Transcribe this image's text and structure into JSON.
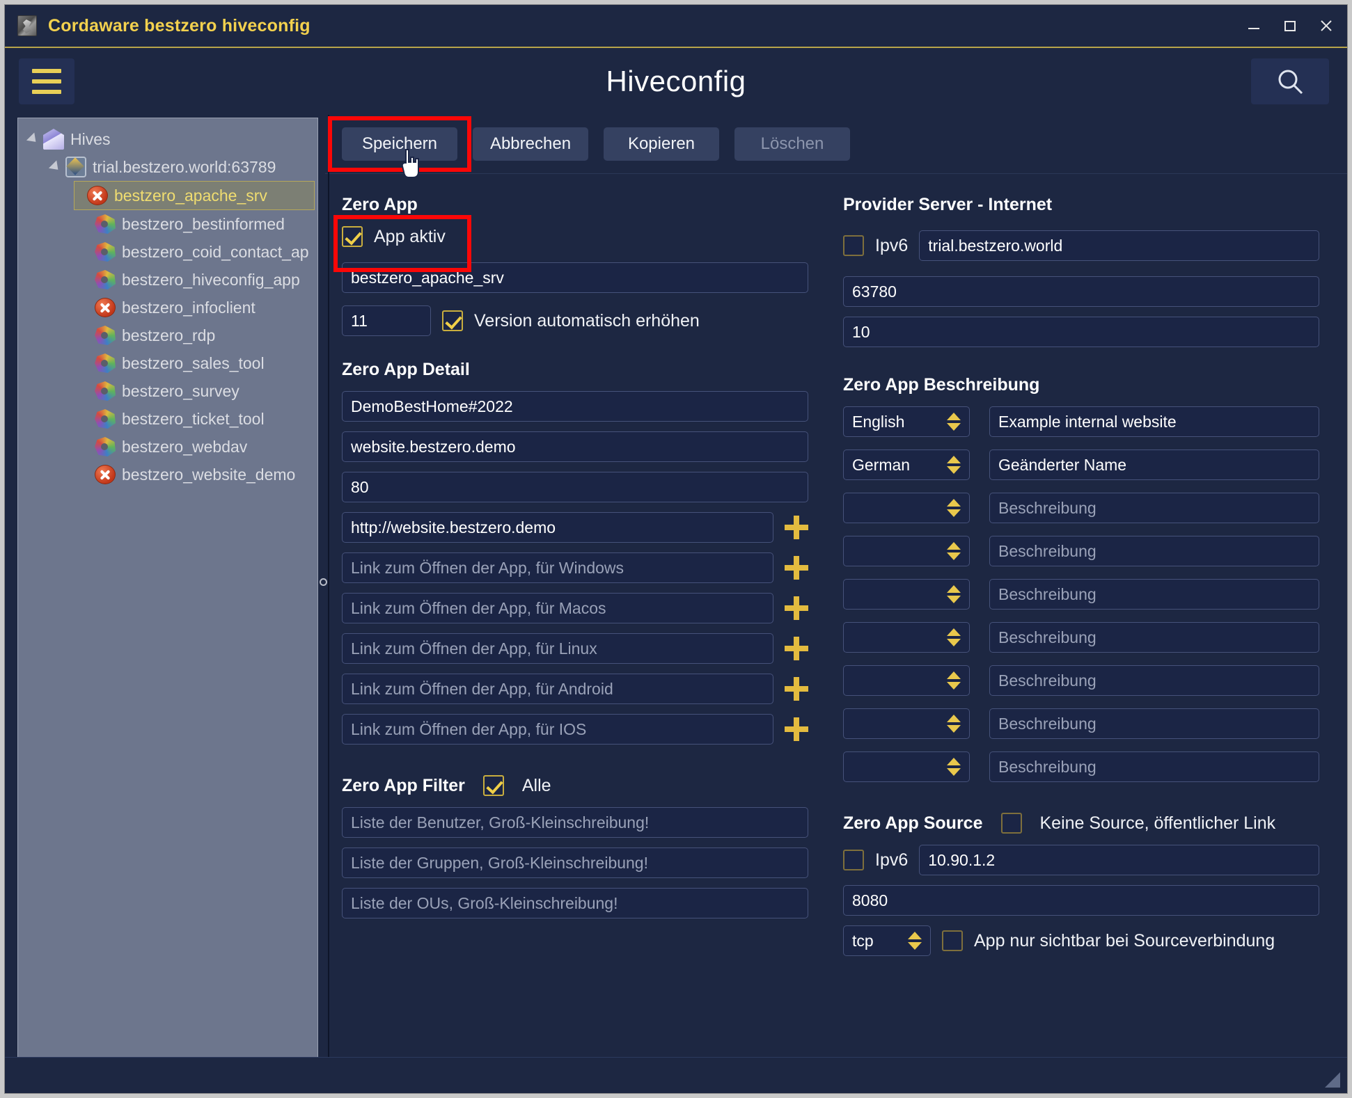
{
  "window": {
    "title": "Cordaware bestzero hiveconfig",
    "minimize": "minimize-icon",
    "maximize": "maximize-icon",
    "close": "close-icon"
  },
  "header": {
    "menu_icon": "hamburger-icon",
    "page_title": "Hiveconfig",
    "search_icon": "search-icon"
  },
  "sidebar": {
    "root": {
      "label": "Hives",
      "icon": "hive-icon"
    },
    "server": {
      "label": "trial.bestzero.world:63789",
      "icon": "world-icon"
    },
    "items": [
      {
        "label": "bestzero_apache_srv",
        "icon": "error-icon",
        "selected": true
      },
      {
        "label": "bestzero_bestinformed",
        "icon": "app-icon",
        "selected": false
      },
      {
        "label": "bestzero_coid_contact_ap",
        "icon": "app-icon",
        "selected": false
      },
      {
        "label": "bestzero_hiveconfig_app",
        "icon": "app-icon",
        "selected": false
      },
      {
        "label": "bestzero_infoclient",
        "icon": "error-icon",
        "selected": false
      },
      {
        "label": "bestzero_rdp",
        "icon": "app-icon",
        "selected": false
      },
      {
        "label": "bestzero_sales_tool",
        "icon": "app-icon",
        "selected": false
      },
      {
        "label": "bestzero_survey",
        "icon": "app-icon",
        "selected": false
      },
      {
        "label": "bestzero_ticket_tool",
        "icon": "app-icon",
        "selected": false
      },
      {
        "label": "bestzero_webdav",
        "icon": "app-icon",
        "selected": false
      },
      {
        "label": "bestzero_website_demo",
        "icon": "error-icon",
        "selected": false
      }
    ]
  },
  "toolbar": {
    "save_label": "Speichern",
    "cancel_label": "Abbrechen",
    "copy_label": "Kopieren",
    "delete_label": "Löschen"
  },
  "zero_app": {
    "section_title": "Zero App",
    "app_active_label": "App aktiv",
    "app_active_checked": true,
    "name_value": "bestzero_apache_srv",
    "version_value": "11",
    "auto_version_label": "Version automatisch erhöhen",
    "auto_version_checked": true
  },
  "provider_server": {
    "section_title": "Provider Server - Internet",
    "ipv6_label": "Ipv6",
    "ipv6_checked": false,
    "host_value": "trial.bestzero.world",
    "port_value": "63780",
    "extra_value": "10"
  },
  "zero_app_detail": {
    "section_title": "Zero App Detail",
    "fields": [
      {
        "value": "DemoBestHome#2022",
        "placeholder": "",
        "has_plus": false
      },
      {
        "value": "website.bestzero.demo",
        "placeholder": "",
        "has_plus": false
      },
      {
        "value": "80",
        "placeholder": "",
        "has_plus": false
      },
      {
        "value": "http://website.bestzero.demo",
        "placeholder": "",
        "has_plus": true
      },
      {
        "value": "",
        "placeholder": "Link zum Öffnen der App, für Windows",
        "has_plus": true
      },
      {
        "value": "",
        "placeholder": "Link zum Öffnen der App, für Macos",
        "has_plus": true
      },
      {
        "value": "",
        "placeholder": "Link zum Öffnen der App, für Linux",
        "has_plus": true
      },
      {
        "value": "",
        "placeholder": "Link zum Öffnen der App, für Android",
        "has_plus": true
      },
      {
        "value": "",
        "placeholder": "Link zum Öffnen der App, für IOS",
        "has_plus": true
      }
    ]
  },
  "zero_app_beschreibung": {
    "section_title": "Zero App Beschreibung",
    "rows": [
      {
        "language": "English",
        "text": "Example internal website",
        "placeholder": ""
      },
      {
        "language": "German",
        "text": "Geänderter Name",
        "placeholder": ""
      },
      {
        "language": "",
        "text": "",
        "placeholder": "Beschreibung"
      },
      {
        "language": "",
        "text": "",
        "placeholder": "Beschreibung"
      },
      {
        "language": "",
        "text": "",
        "placeholder": "Beschreibung"
      },
      {
        "language": "",
        "text": "",
        "placeholder": "Beschreibung"
      },
      {
        "language": "",
        "text": "",
        "placeholder": "Beschreibung"
      },
      {
        "language": "",
        "text": "",
        "placeholder": "Beschreibung"
      },
      {
        "language": "",
        "text": "",
        "placeholder": "Beschreibung"
      }
    ]
  },
  "zero_app_filter": {
    "section_title": "Zero App Filter",
    "all_label": "Alle",
    "all_checked": true,
    "fields": [
      {
        "placeholder": "Liste der Benutzer, Groß-Kleinschreibung!"
      },
      {
        "placeholder": "Liste der Gruppen, Groß-Kleinschreibung!"
      },
      {
        "placeholder": "Liste der OUs, Groß-Kleinschreibung!"
      }
    ]
  },
  "zero_app_source": {
    "section_title": "Zero App Source",
    "no_source_label": "Keine Source, öffentlicher Link",
    "no_source_checked": false,
    "ipv6_label": "Ipv6",
    "ipv6_checked": false,
    "host_value": "10.90.1.2",
    "port_value": "8080",
    "protocol_value": "tcp",
    "visible_only_label": "App nur sichtbar bei Sourceverbindung",
    "visible_only_checked": false
  },
  "colors": {
    "window_bg": "#1d2742",
    "accent_yellow": "#f3d14e",
    "highlight_red": "#fb0707",
    "sidebar_bg": "#6d768d",
    "button_bg": "#354161"
  }
}
